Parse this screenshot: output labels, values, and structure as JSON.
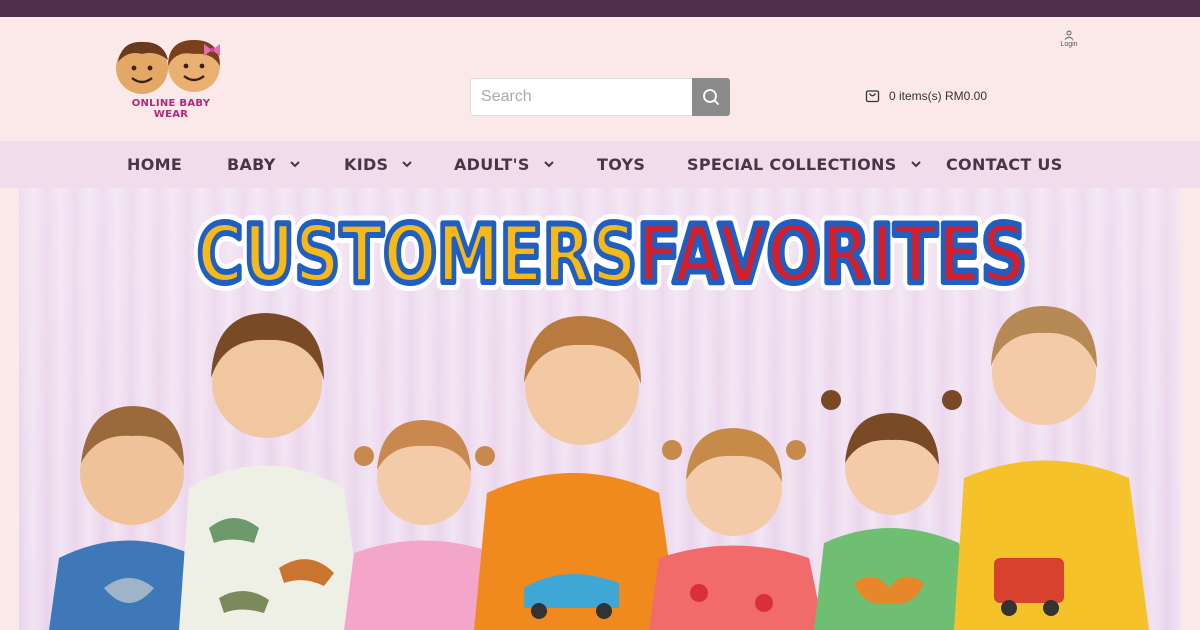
{
  "header": {
    "logo": {
      "line1": "ONLINE BABY",
      "line2": "WEAR"
    },
    "login_label": "Login",
    "search": {
      "placeholder": "Search"
    },
    "cart": {
      "text": "0 items(s) RM0.00"
    }
  },
  "nav": {
    "items": [
      {
        "label": "HOME",
        "has_dropdown": false
      },
      {
        "label": "BABY",
        "has_dropdown": true
      },
      {
        "label": "KIDS",
        "has_dropdown": true
      },
      {
        "label": "ADULT'S",
        "has_dropdown": true
      },
      {
        "label": "TOYS",
        "has_dropdown": false
      },
      {
        "label": "SPECIAL COLLECTIONS",
        "has_dropdown": true
      },
      {
        "label": "CONTACT US",
        "has_dropdown": false
      }
    ]
  },
  "hero": {
    "headline_part1": "CUSTOMERS",
    "headline_part2": "FAVORITES"
  },
  "colors": {
    "topbar": "#4e2e4a",
    "header_bg": "#fbe9e9",
    "nav_bg": "#f1dcec",
    "nav_text": "#4a3446",
    "logo_text": "#b5267a",
    "headline_yellow": "#f7b818",
    "headline_red": "#d11f2c",
    "headline_outline": "#1f5fc4"
  }
}
